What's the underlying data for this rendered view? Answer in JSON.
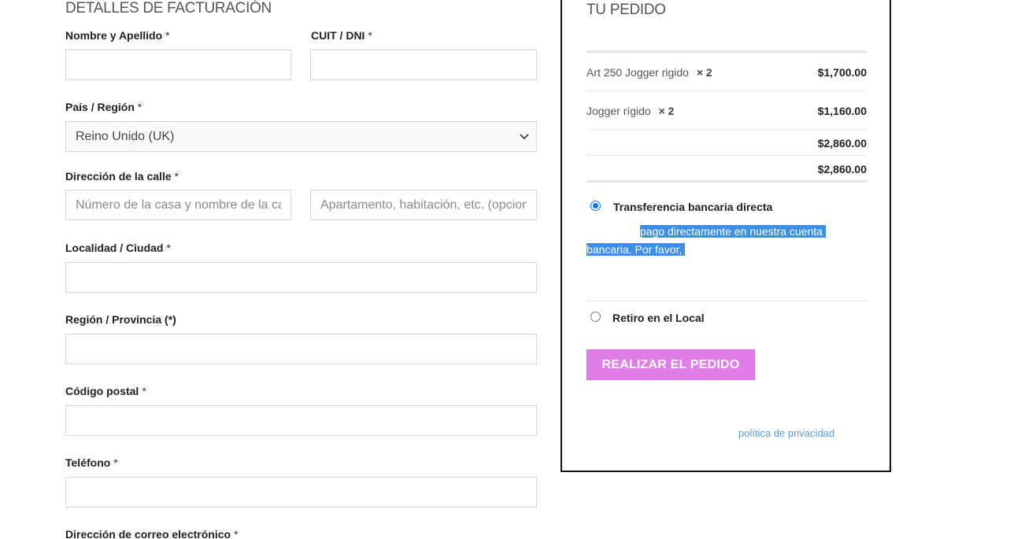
{
  "billing": {
    "title": "DETALLES DE FACTURACIÓN",
    "name_label": "Nombre y Apellido",
    "cuit_label": "CUIT / DNI",
    "country_label": "País / Región",
    "country_value": "Reino Unido (UK)",
    "street_label": "Dirección de la calle",
    "street_placeholder": "Número de la casa y nombre de la calle",
    "apt_placeholder": "Apartamento, habitación, etc. (opcional)",
    "city_label": "Localidad / Ciudad",
    "region_label": "Región / Provincia (*)",
    "postal_label": "Código postal",
    "phone_label": "Teléfono",
    "email_label": "Dirección de correo electrónico",
    "required_mark": "*"
  },
  "order": {
    "title": "TU PEDIDO",
    "items": [
      {
        "name": "Art 250 Jogger rigido",
        "qty": "× 2",
        "price": "$1,700.00"
      },
      {
        "name": "Jogger rígido",
        "qty": "× 2",
        "price": "$1,160.00"
      }
    ],
    "subtotal": "$2,860.00",
    "total": "$2,860.00",
    "payment_bank_label": "Transferencia bancaria directa",
    "payment_bank_desc_1": "pago directamente en nuestra cuenta",
    "payment_bank_desc_2": "bancaria. Por favor,",
    "payment_pickup_label": "Retiro en el Local",
    "place_order_label": "REALIZAR EL PEDIDO",
    "privacy_link": "política de privacidad"
  },
  "colors": {
    "button": "#e07de9",
    "selection": "#3b8fe8",
    "link": "#5a9be0"
  },
  "icons": {
    "select_arrow": "chevron-down-icon"
  }
}
